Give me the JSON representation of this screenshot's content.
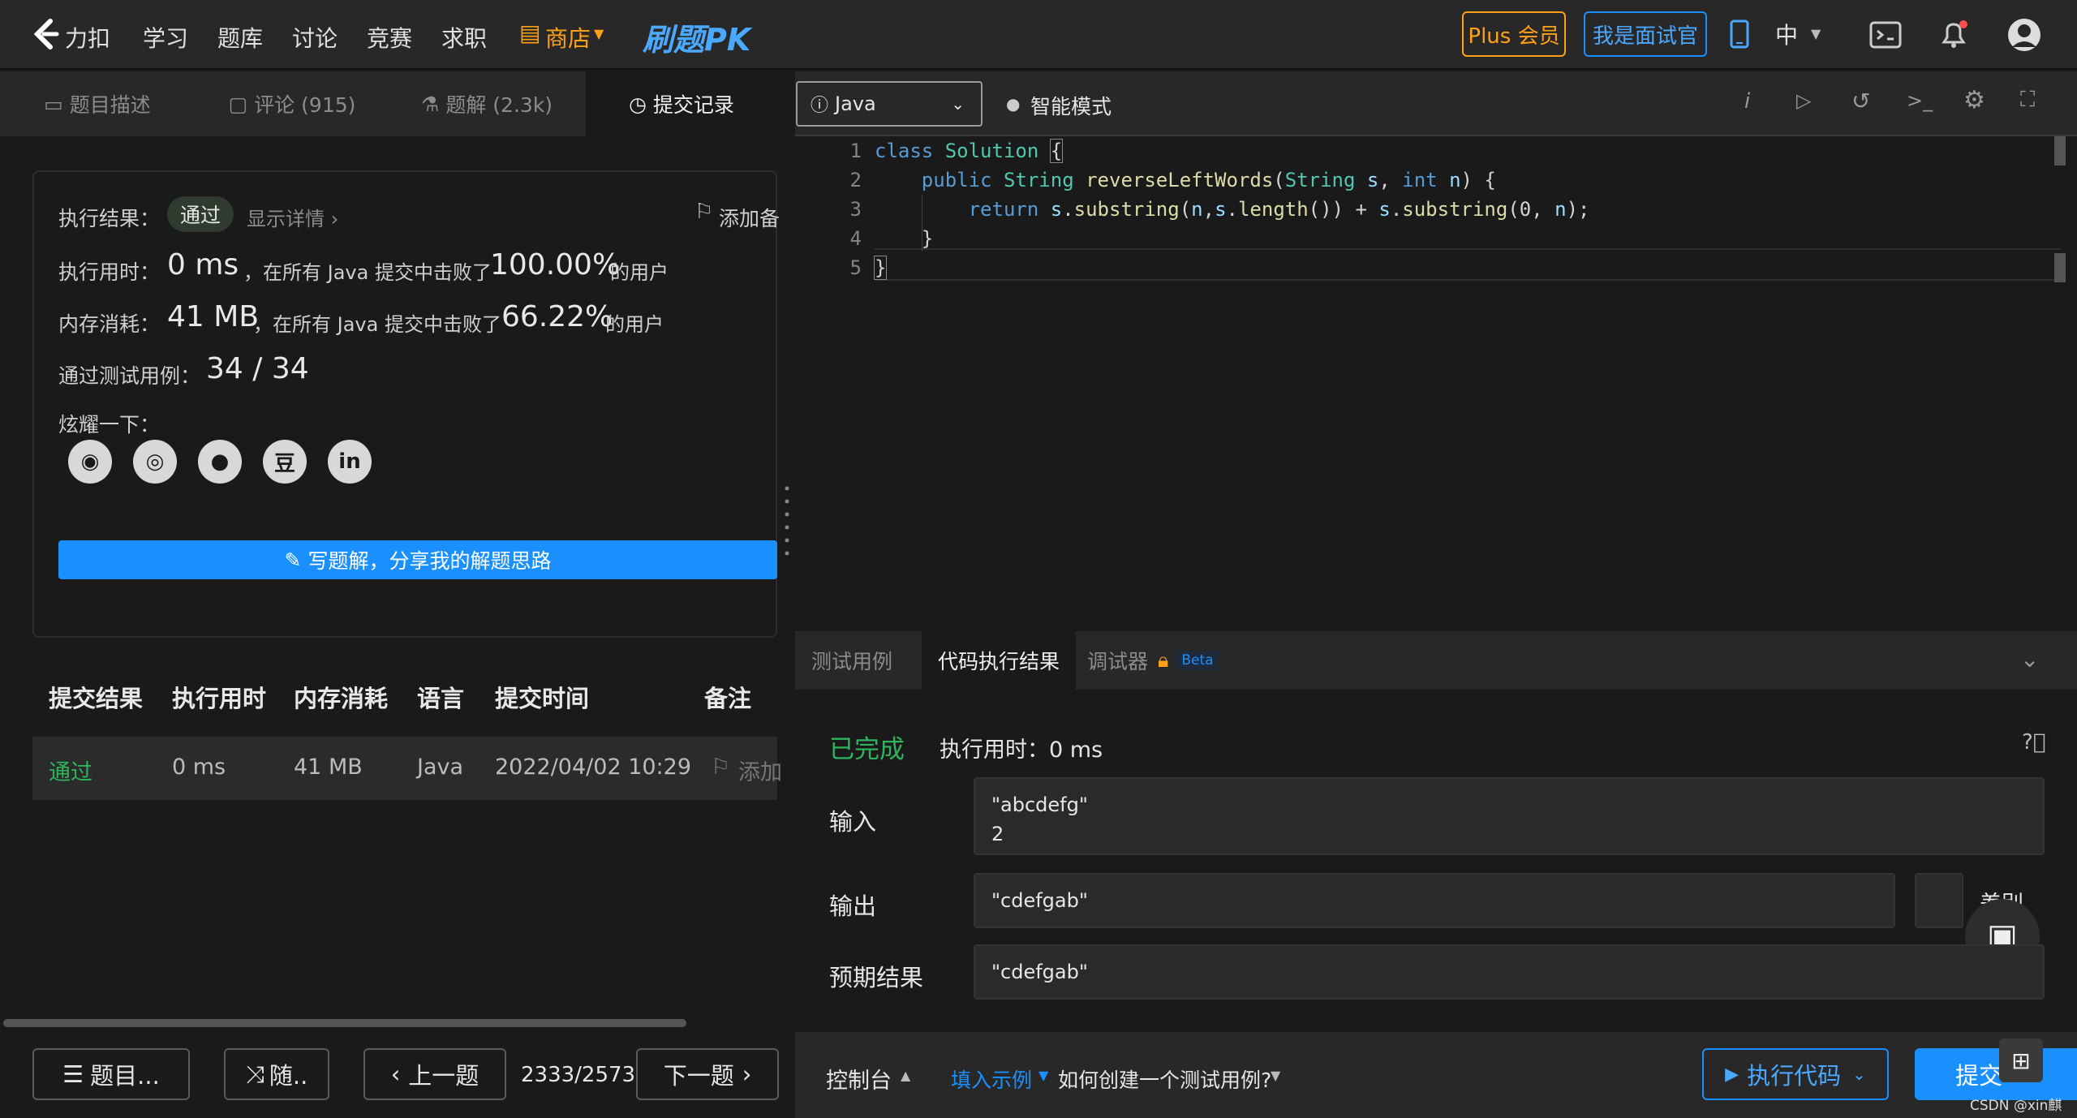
{
  "nav": {
    "logo_text": "力扣",
    "items": [
      "学习",
      "题库",
      "讨论",
      "竞赛",
      "求职"
    ],
    "store": "商店",
    "pk_label": "刷题PK",
    "plus": "Plus 会员",
    "interviewer": "我是面试官",
    "lang": "中"
  },
  "left_tabs": [
    {
      "label": "题目描述"
    },
    {
      "label": "评论 (915)"
    },
    {
      "label": "题解 (2.3k)"
    },
    {
      "label": "提交记录"
    }
  ],
  "result": {
    "status_label": "执行结果：",
    "status": "通过",
    "details": "显示详情 ›",
    "add_note": "添加备",
    "time_label": "执行用时：",
    "time_value": "0 ms",
    "time_text": "，在所有 Java 提交中击败了",
    "time_pct": "100.00%",
    "users": "的用户",
    "mem_label": "内存消耗：",
    "mem_value": "41 MB",
    "mem_text": "，在所有 Java 提交中击败了",
    "mem_pct": "66.22%",
    "cases_label": "通过测试用例：",
    "cases_value": "34  /  34",
    "share_label": "炫耀一下：",
    "write_btn": "写题解，分享我的解题思路"
  },
  "table": {
    "headers": [
      "提交结果",
      "执行用时",
      "内存消耗",
      "语言",
      "提交时间",
      "备注"
    ],
    "rows": [
      {
        "status": "通过",
        "time": "0 ms",
        "memory": "41 MB",
        "lang": "Java",
        "submitted": "2022/04/02 10:29",
        "note": "添加"
      }
    ]
  },
  "bottom_left": {
    "list_btn": "题目...",
    "random_btn": "随..",
    "prev_btn": "上一题",
    "progress": "2333/2573",
    "next_btn": "下一题"
  },
  "editor": {
    "language": "Java",
    "mode": "智能模式",
    "line_numbers": [
      "1",
      "2",
      "3",
      "4",
      "5"
    ]
  },
  "result_tabs": {
    "test_case": "测试用例",
    "run_result": "代码执行结果",
    "debugger": "调试器",
    "beta": "Beta"
  },
  "run": {
    "status": "已完成",
    "time": "执行用时：0 ms",
    "input_label": "输入",
    "input_value": "\"abcdefg\"\n2",
    "output_label": "输出",
    "output_value": "\"cdefgab\"",
    "diff_label": "差别",
    "expected_label": "预期结果",
    "expected_value": "\"cdefgab\""
  },
  "bottom_right": {
    "console": "控制台",
    "fill_example": "填入示例",
    "how_create": "如何创建一个测试用例?",
    "run_btn": "执行代码",
    "submit_btn": "提交",
    "watermark": "CSDN @xin麒"
  },
  "colors": {
    "accent_blue": "#1a90ff",
    "success_green": "#2db55d",
    "store_orange": "#ffa116"
  }
}
